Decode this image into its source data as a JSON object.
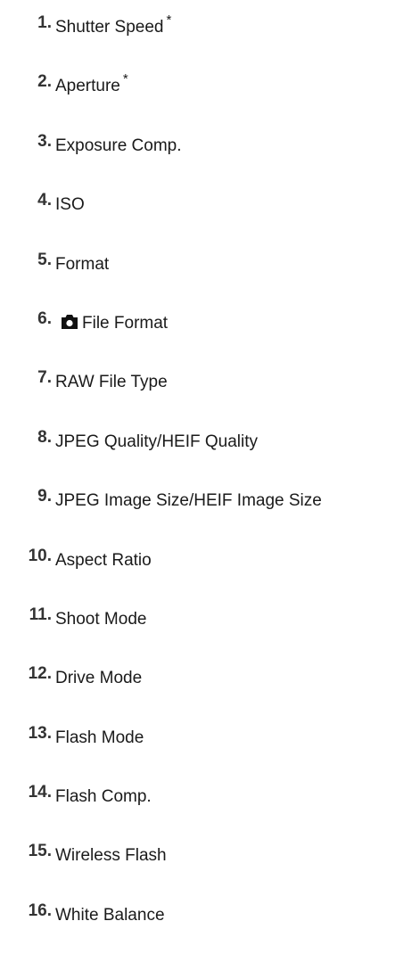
{
  "items": [
    {
      "num": "1.",
      "label": "Shutter Speed",
      "star": "*"
    },
    {
      "num": "2.",
      "label": "Aperture",
      "star": "*"
    },
    {
      "num": "3.",
      "label": "Exposure Comp."
    },
    {
      "num": "4.",
      "label": "ISO"
    },
    {
      "num": "5.",
      "label": "Format"
    },
    {
      "num": "6.",
      "label": "File Format",
      "icon": "still-camera-icon"
    },
    {
      "num": "7.",
      "label": "RAW File Type"
    },
    {
      "num": "8.",
      "label": "JPEG Quality/HEIF Quality"
    },
    {
      "num": "9.",
      "label": "JPEG Image Size/HEIF Image Size"
    },
    {
      "num": "10.",
      "label": "Aspect Ratio"
    },
    {
      "num": "11.",
      "label": "Shoot Mode"
    },
    {
      "num": "12.",
      "label": "Drive Mode"
    },
    {
      "num": "13.",
      "label": "Flash Mode"
    },
    {
      "num": "14.",
      "label": "Flash Comp."
    },
    {
      "num": "15.",
      "label": "Wireless Flash"
    },
    {
      "num": "16.",
      "label": "White Balance"
    }
  ]
}
